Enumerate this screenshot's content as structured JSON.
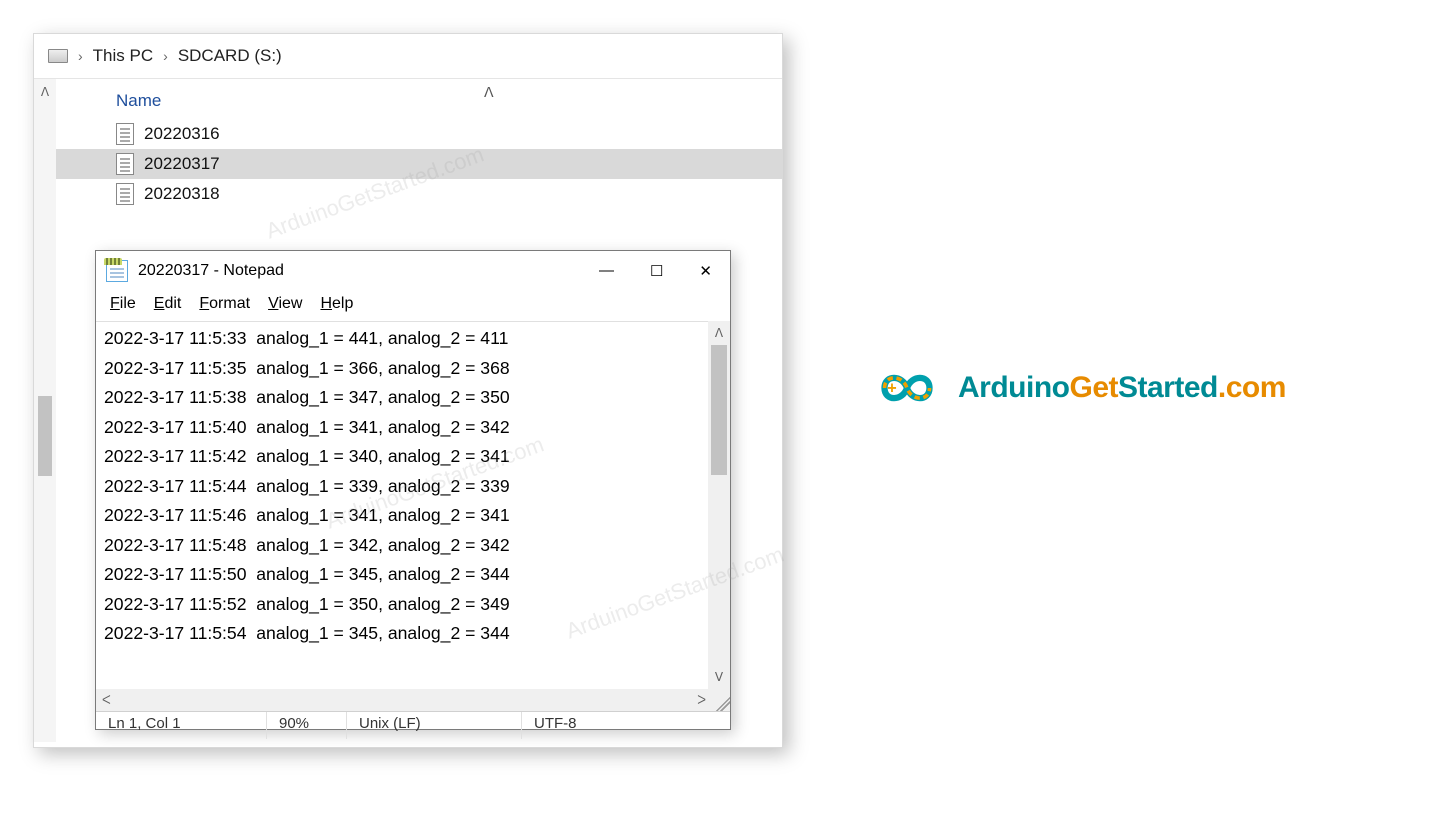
{
  "explorer": {
    "breadcrumb": [
      "This PC",
      "SDCARD (S:)"
    ],
    "column_header": "Name",
    "files": [
      {
        "name": "20220316",
        "selected": false
      },
      {
        "name": "20220317",
        "selected": true
      },
      {
        "name": "20220318",
        "selected": false
      }
    ]
  },
  "notepad": {
    "title": "20220317 - Notepad",
    "menu": [
      "File",
      "Edit",
      "Format",
      "View",
      "Help"
    ],
    "lines": [
      "2022-3-17 11:5:33  analog_1 = 441, analog_2 = 411",
      "2022-3-17 11:5:35  analog_1 = 366, analog_2 = 368",
      "2022-3-17 11:5:38  analog_1 = 347, analog_2 = 350",
      "2022-3-17 11:5:40  analog_1 = 341, analog_2 = 342",
      "2022-3-17 11:5:42  analog_1 = 340, analog_2 = 341",
      "2022-3-17 11:5:44  analog_1 = 339, analog_2 = 339",
      "2022-3-17 11:5:46  analog_1 = 341, analog_2 = 341",
      "2022-3-17 11:5:48  analog_1 = 342, analog_2 = 342",
      "2022-3-17 11:5:50  analog_1 = 345, analog_2 = 344",
      "2022-3-17 11:5:52  analog_1 = 350, analog_2 = 349",
      "2022-3-17 11:5:54  analog_1 = 345, analog_2 = 344"
    ],
    "status": {
      "pos": "Ln 1, Col 1",
      "zoom": "90%",
      "line_ending": "Unix (LF)",
      "encoding": "UTF-8"
    }
  },
  "logo": {
    "t1": "Arduino",
    "t2": "Get",
    "t3": "Started",
    "t4": ".com"
  },
  "watermark_text": "ArduinoGetStarted.com"
}
